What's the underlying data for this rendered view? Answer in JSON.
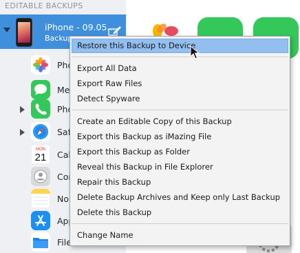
{
  "sidebar": {
    "section_header": "EDITABLE BACKUPS",
    "device": {
      "name": "iPhone - 09.05...",
      "subtitle": "Backup"
    },
    "apps": [
      {
        "label": "Pho",
        "icon": "photos-icon",
        "expandable": false
      },
      {
        "label": "Me",
        "icon": "messages-icon",
        "expandable": false
      },
      {
        "label": "Pho",
        "icon": "phone-icon",
        "expandable": true
      },
      {
        "label": "Saf",
        "icon": "safari-icon",
        "expandable": true
      },
      {
        "label": "Cal",
        "icon": "calendar-icon",
        "expandable": false,
        "calendar_day": "MON",
        "calendar_date": "21"
      },
      {
        "label": "Cor",
        "icon": "contacts-icon",
        "expandable": false
      },
      {
        "label": "No",
        "icon": "notes-icon",
        "expandable": false
      },
      {
        "label": "App",
        "icon": "app-store-icon",
        "expandable": false
      },
      {
        "label": "File",
        "icon": "files-icon",
        "expandable": false
      }
    ]
  },
  "context_menu": {
    "groups": [
      [
        "Restore this Backup to Device"
      ],
      [
        "Export All Data",
        "Export Raw Files",
        "Detect Spyware"
      ],
      [
        "Create an Editable Copy of this Backup",
        "Export this Backup as iMazing File",
        "Export this Backup as Folder",
        "Reveal this Backup in File Explorer",
        "Repair this Backup",
        "Delete Backup Archives and Keep only Last Backup",
        "Delete this Backup"
      ],
      [
        "Change Name"
      ]
    ],
    "highlighted_item": "Restore this Backup to Device"
  },
  "colors": {
    "selection_blue": "#3f8fdc",
    "menu_highlight": "#92bef0",
    "sidebar_bg": "#eef0f3"
  }
}
